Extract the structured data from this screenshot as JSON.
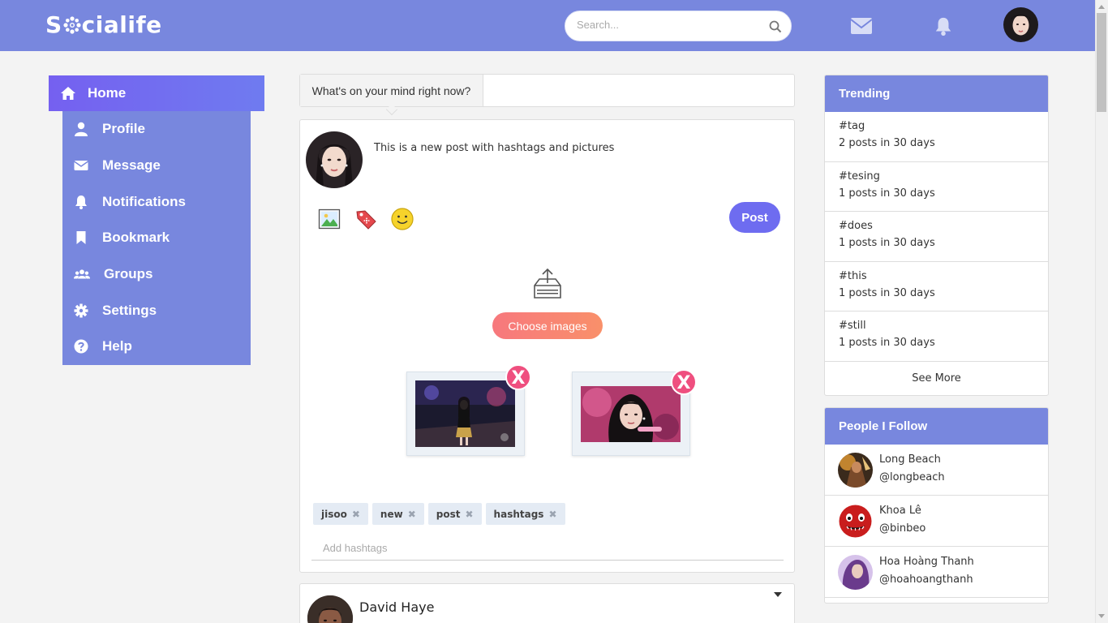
{
  "app": {
    "logo_text_pre": "S",
    "logo_text_post": "cialife"
  },
  "header": {
    "search_placeholder": "Search...",
    "icons": [
      "envelope-icon",
      "bell-icon"
    ]
  },
  "sidebar": {
    "home": {
      "label": "Home",
      "icon": "home-icon"
    },
    "items": [
      {
        "label": "Profile",
        "icon": "user-icon"
      },
      {
        "label": "Message",
        "icon": "envelope-icon"
      },
      {
        "label": "Notifications",
        "icon": "bell-icon"
      },
      {
        "label": "Bookmark",
        "icon": "bookmark-icon"
      },
      {
        "label": "Groups",
        "icon": "users-icon"
      },
      {
        "label": "Settings",
        "icon": "gear-icon"
      },
      {
        "label": "Help",
        "icon": "question-icon"
      }
    ]
  },
  "composer": {
    "prompt": "What's on your mind right now?",
    "text": "This is a new post with hashtags and pictures",
    "post_label": "Post",
    "choose_label": "Choose images",
    "remove_label": "X",
    "tags": [
      {
        "label": "jisoo"
      },
      {
        "label": "new"
      },
      {
        "label": "post"
      },
      {
        "label": "hashtags"
      }
    ],
    "tag_remove": "✖",
    "hashtag_placeholder": "Add hashtags"
  },
  "feed": {
    "author": "David Haye"
  },
  "trending": {
    "title": "Trending",
    "items": [
      {
        "tag": "#tag",
        "count": "2 posts in 30 days"
      },
      {
        "tag": "#tesing",
        "count": "1 posts in 30 days"
      },
      {
        "tag": "#does",
        "count": "1 posts in 30 days"
      },
      {
        "tag": "#this",
        "count": "1 posts in 30 days"
      },
      {
        "tag": "#still",
        "count": "1 posts in 30 days"
      }
    ],
    "see_more": "See More"
  },
  "following": {
    "title": "People I Follow",
    "people": [
      {
        "name": "Long Beach",
        "handle": "@longbeach"
      },
      {
        "name": "Khoa Lê",
        "handle": "@binbeo"
      },
      {
        "name": "Hoa Hoàng Thanh",
        "handle": "@hoahoangthanh"
      }
    ]
  },
  "colors": {
    "header": "#7887de",
    "accent": "#6e6cf0",
    "remove": "#ef4f7f",
    "choose": "#f7787d"
  }
}
